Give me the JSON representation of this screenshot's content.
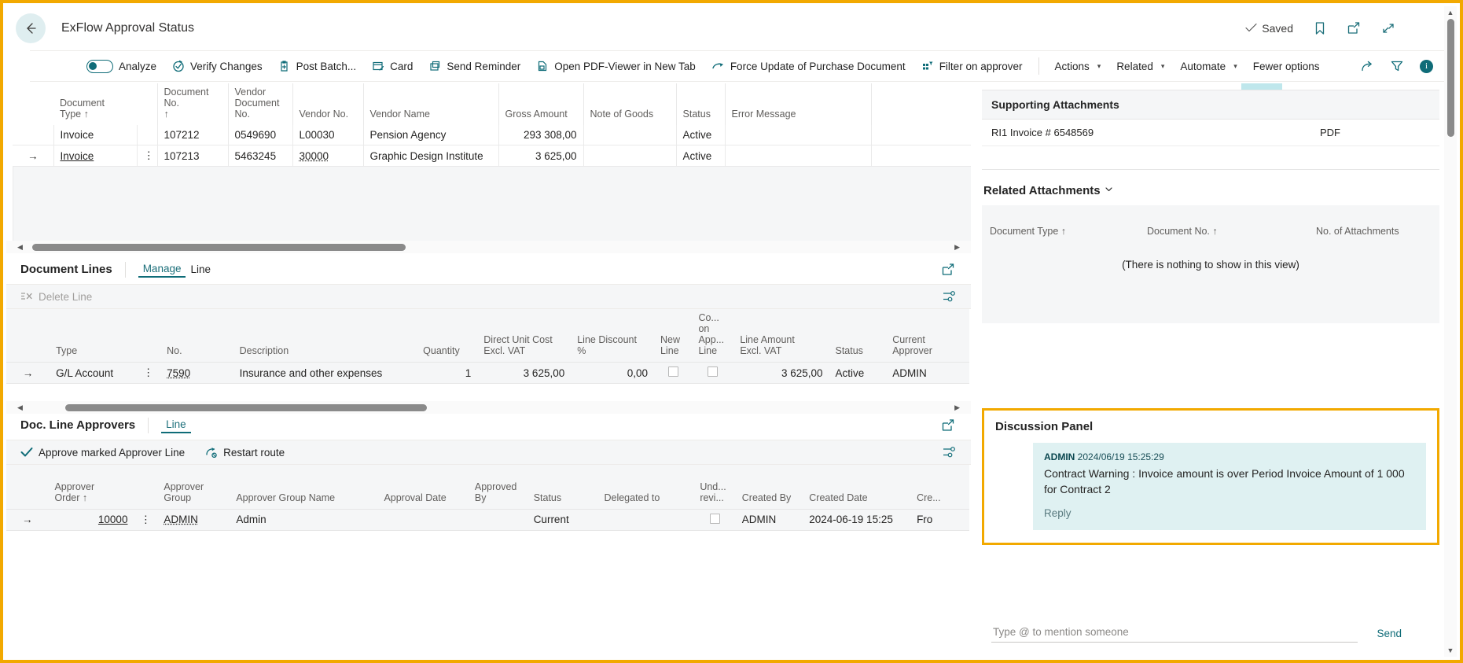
{
  "header": {
    "back_icon": "back-arrow-icon",
    "title": "ExFlow Approval Status",
    "saved_label": "Saved",
    "saved_icon": "check-icon",
    "bookmark_icon": "bookmark-icon",
    "open_new_window_icon": "open-in-new-window-icon",
    "collapse_icon": "collapse-icon"
  },
  "toolbar": {
    "analyze_label": "Analyze",
    "items": [
      {
        "label": "Verify Changes",
        "icon": "verify-changes-icon"
      },
      {
        "label": "Post Batch...",
        "icon": "post-batch-icon"
      },
      {
        "label": "Card",
        "icon": "card-icon"
      },
      {
        "label": "Send Reminder",
        "icon": "send-reminder-icon"
      },
      {
        "label": "Open PDF-Viewer in New Tab",
        "icon": "pdf-viewer-icon"
      },
      {
        "label": "Force Update of Purchase Document",
        "icon": "force-update-icon"
      },
      {
        "label": "Filter on approver",
        "icon": "filter-on-approver-icon"
      }
    ],
    "menus": [
      {
        "label": "Actions"
      },
      {
        "label": "Related"
      },
      {
        "label": "Automate"
      }
    ],
    "fewer_options": "Fewer options",
    "share_icon": "share-icon",
    "filter_icon": "filter-icon",
    "info_icon": "info-icon",
    "info_glyph": "i"
  },
  "documents": {
    "columns": [
      "Document\nType ↑",
      "Document No.\n↑",
      "Vendor\nDocument\nNo.",
      "Vendor No.",
      "Vendor Name",
      "Gross Amount",
      "Note of Goods",
      "Status",
      "Error Message"
    ],
    "rows": [
      {
        "selector": "",
        "document_type": "Invoice",
        "document_no": "107212",
        "vendor_document_no": "0549690",
        "vendor_no": "L00030",
        "vendor_name": "Pension Agency",
        "gross_amount": "293 308,00",
        "note_of_goods": "",
        "status": "Active",
        "error_message": "",
        "selected": false
      },
      {
        "selector": "→",
        "document_type": "Invoice",
        "document_no": "107213",
        "vendor_document_no": "5463245",
        "vendor_no": "30000",
        "vendor_name": "Graphic Design Institute",
        "gross_amount": "3 625,00",
        "note_of_goods": "",
        "status": "Active",
        "error_message": "",
        "selected": true
      }
    ]
  },
  "document_lines": {
    "title": "Document Lines",
    "tabs": [
      {
        "label": "Manage",
        "active": true
      },
      {
        "label": "Line",
        "active": false
      }
    ],
    "expand_icon": "open-in-new-window-icon",
    "commands": [
      {
        "label": "Delete Line",
        "icon": "delete-line-icon",
        "disabled": true
      }
    ],
    "settings_icon": "personalize-icon",
    "columns": [
      "Type",
      "No.",
      "Description",
      "Quantity",
      "Direct Unit Cost\nExcl. VAT",
      "Line Discount %",
      "New\nLine",
      "Co...\non\nApp...\nLine",
      "Line Amount\nExcl. VAT",
      "Status",
      "Current\nApprover"
    ],
    "rows": [
      {
        "selector": "→",
        "type": "G/L Account",
        "no": "7590",
        "description": "Insurance and other expenses",
        "quantity": "1",
        "direct_unit_cost_excl_vat": "3 625,00",
        "line_discount_pct": "0,00",
        "new_line": false,
        "comment_on_approval_line": false,
        "line_amount_excl_vat": "3 625,00",
        "status": "Active",
        "current_approver": "ADMIN"
      }
    ]
  },
  "doc_line_approvers": {
    "title": "Doc. Line Approvers",
    "tabs": [
      {
        "label": "Line",
        "active": true
      }
    ],
    "expand_icon": "open-in-new-window-icon",
    "commands": [
      {
        "label": "Approve marked Approver Line",
        "icon": "approve-check-icon",
        "disabled": false
      },
      {
        "label": "Restart route",
        "icon": "restart-route-icon",
        "disabled": false
      }
    ],
    "settings_icon": "personalize-icon",
    "columns": [
      "Approver\nOrder ↑",
      "Approver\nGroup",
      "Approver Group Name",
      "Approval Date",
      "Approved\nBy",
      "Status",
      "Delegated to",
      "Und...\nrevi...",
      "Created By",
      "Created Date",
      "Cre..."
    ],
    "rows": [
      {
        "selector": "→",
        "approver_order": "10000",
        "approver_group": "ADMIN",
        "approver_group_name": "Admin",
        "approval_date": "",
        "approved_by": "",
        "status": "Current",
        "delegated_to": "",
        "under_review": false,
        "created_by": "ADMIN",
        "created_date": "2024-06-19 15:25",
        "created_extra": "Fro"
      }
    ]
  },
  "supporting_attachments": {
    "title": "Supporting Attachments",
    "rows": [
      {
        "name": "RI1 Invoice # 6548569",
        "type": "PDF"
      }
    ]
  },
  "related_attachments": {
    "title": "Related Attachments",
    "chevron_icon": "chevron-down-icon",
    "columns": [
      "Document Type ↑",
      "Document No. ↑",
      "No. of Attachments"
    ],
    "empty_text": "(There is nothing to show in this view)"
  },
  "discussion_panel": {
    "title": "Discussion Panel",
    "messages": [
      {
        "author": "ADMIN",
        "timestamp": "2024/06/19 15:25:29",
        "text": "Contract Warning : Invoice amount is over Period Invoice Amount of 1 000 for Contract 2",
        "reply_label": "Reply"
      }
    ],
    "composer_placeholder": "Type @ to mention someone",
    "send_label": "Send"
  },
  "colors": {
    "accent_teal": "#0f6c78",
    "highlight_orange": "#F2A900",
    "row_select_teal": "#bfe7ec",
    "message_bg": "#dff1f2"
  }
}
